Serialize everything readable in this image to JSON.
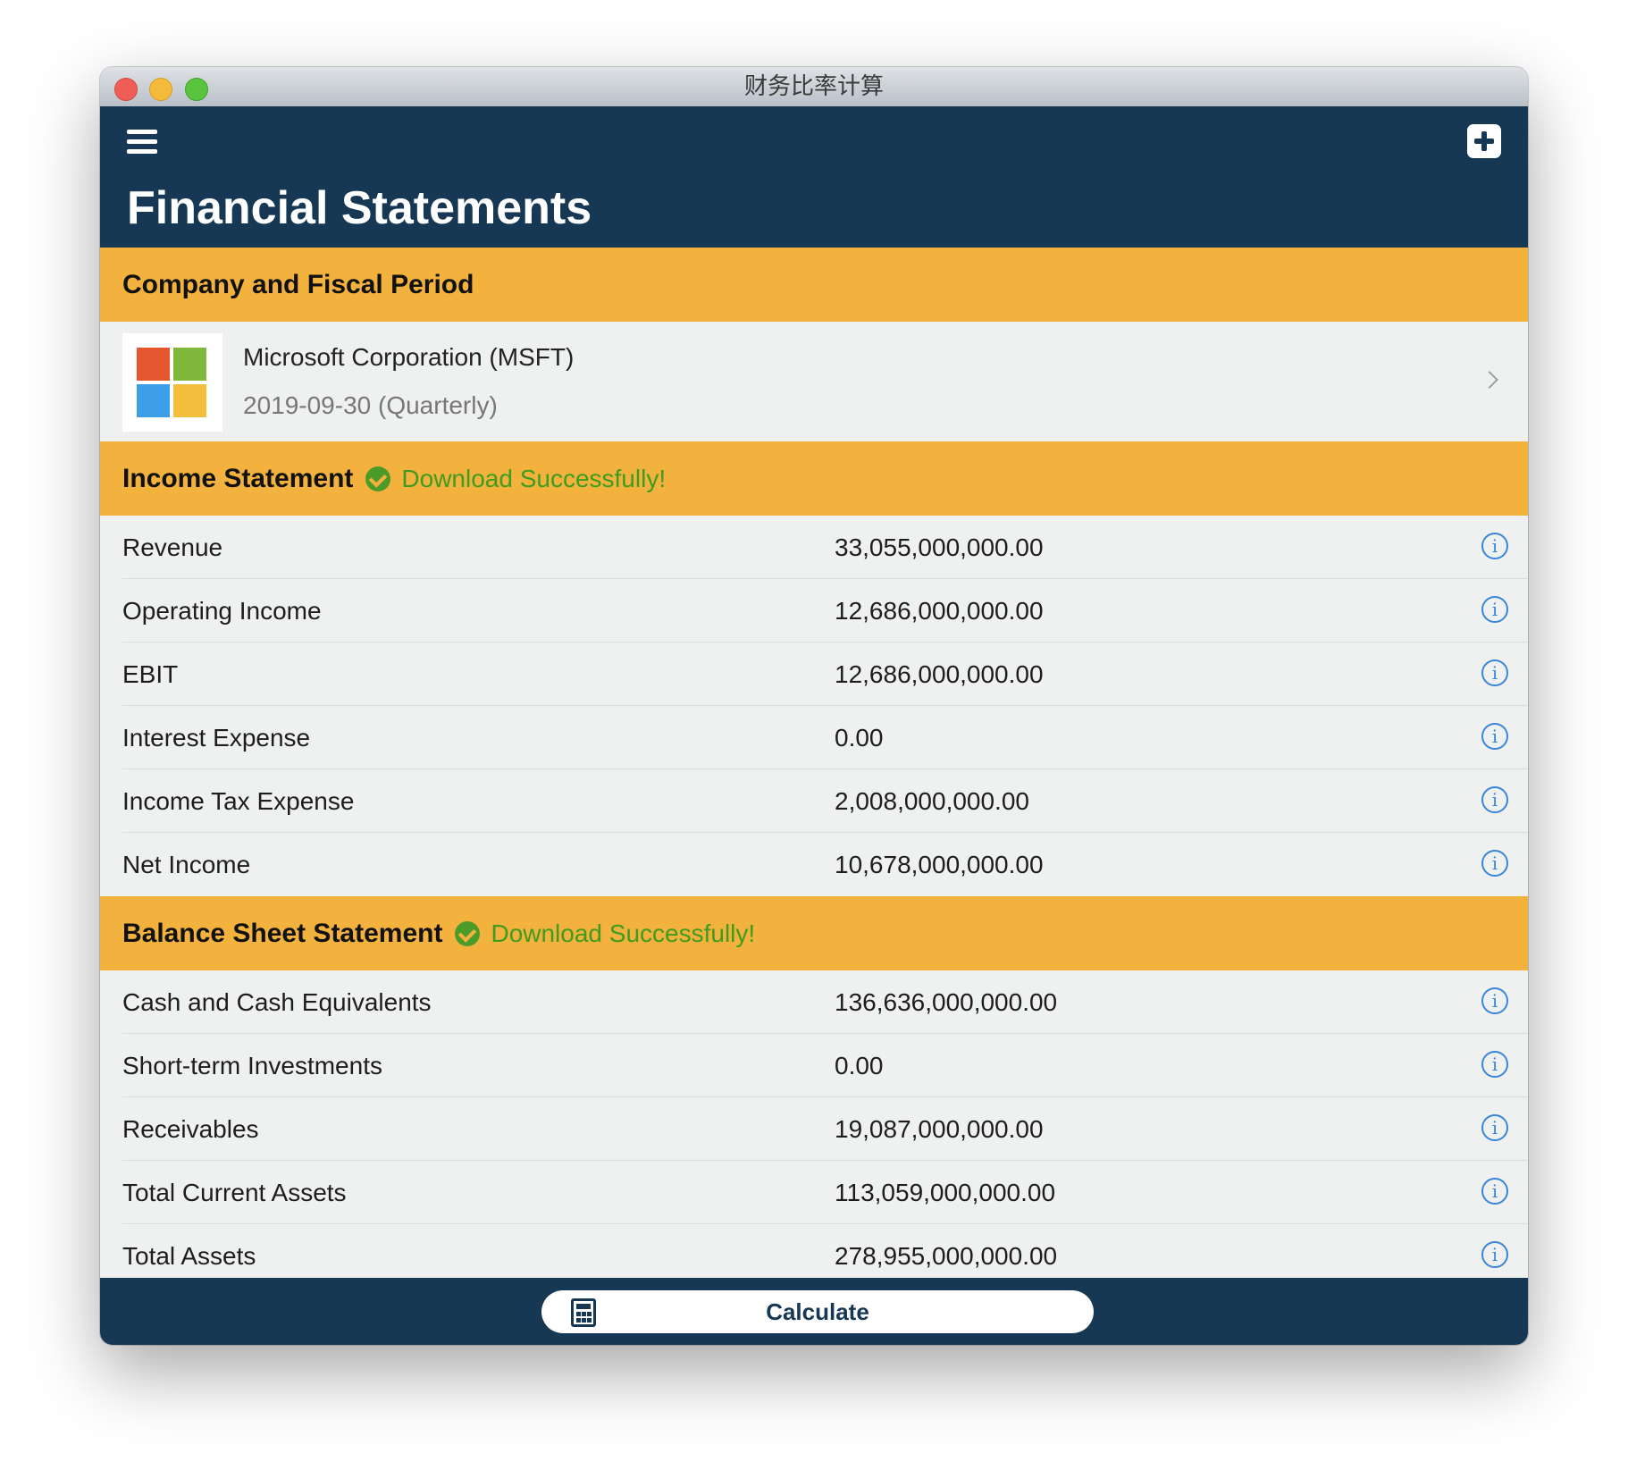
{
  "window": {
    "title": "财务比率计算"
  },
  "navbar": {
    "title": "Financial Statements"
  },
  "company_section": {
    "header": "Company and Fiscal Period",
    "company_name": "Microsoft Corporation (MSFT)",
    "period": "2019-09-30 (Quarterly)"
  },
  "income_statement": {
    "header": "Income Statement",
    "status": "Download Successfully!",
    "rows": [
      {
        "label": "Revenue",
        "value": "33,055,000,000.00"
      },
      {
        "label": "Operating Income",
        "value": "12,686,000,000.00"
      },
      {
        "label": "EBIT",
        "value": "12,686,000,000.00"
      },
      {
        "label": "Interest Expense",
        "value": "0.00"
      },
      {
        "label": "Income Tax Expense",
        "value": "2,008,000,000.00"
      },
      {
        "label": "Net Income",
        "value": "10,678,000,000.00"
      }
    ]
  },
  "balance_sheet": {
    "header": "Balance Sheet Statement",
    "status": "Download Successfully!",
    "rows": [
      {
        "label": "Cash and Cash Equivalents",
        "value": "136,636,000,000.00"
      },
      {
        "label": "Short-term Investments",
        "value": "0.00"
      },
      {
        "label": "Receivables",
        "value": "19,087,000,000.00"
      },
      {
        "label": "Total Current Assets",
        "value": "113,059,000,000.00"
      },
      {
        "label": "Total Assets",
        "value": "278,955,000,000.00"
      }
    ]
  },
  "bottom": {
    "calculate_label": "Calculate"
  },
  "icons": {
    "menu": "hamburger-menu-icon",
    "add": "plus-square-icon",
    "status": "check-circle-icon",
    "info": "info-circle-icon",
    "chevron": "chevron-right-icon",
    "calculator": "calculator-icon"
  },
  "colors": {
    "navbar": "#163854",
    "section_header": "#f3b13d",
    "success": "#3f9c1e",
    "info": "#3a86d9"
  }
}
